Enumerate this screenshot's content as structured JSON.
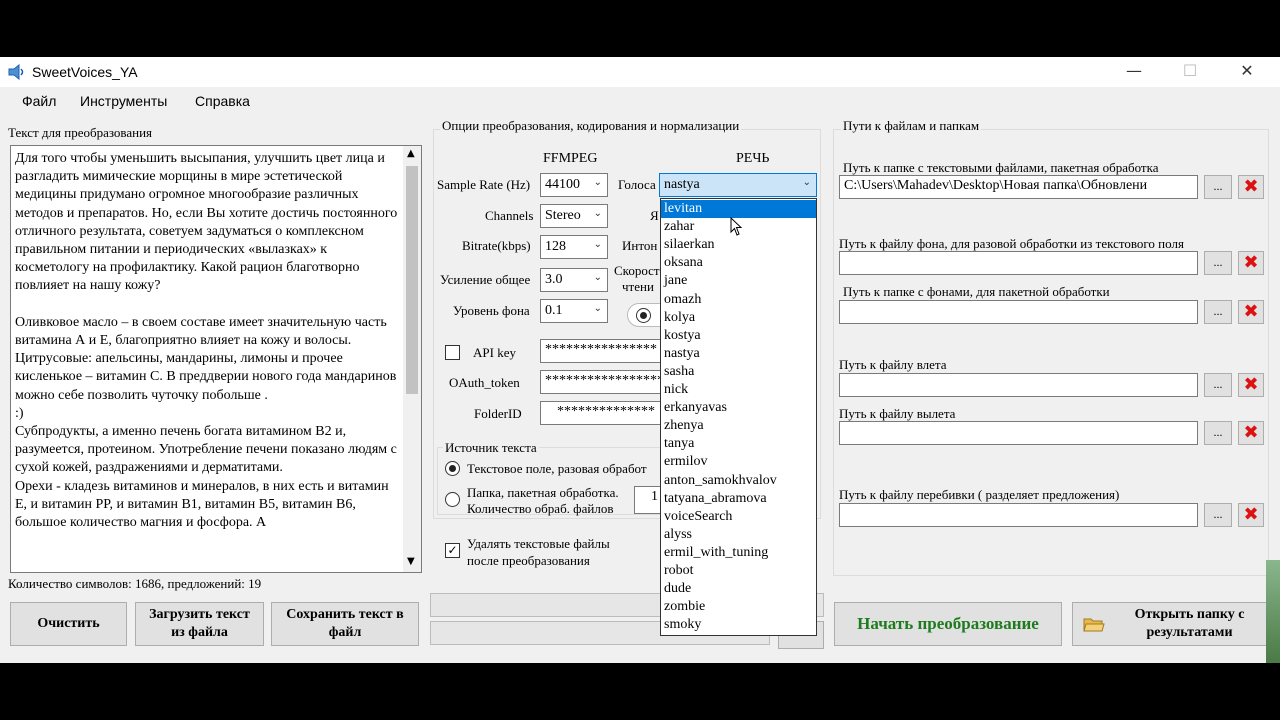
{
  "window": {
    "title": "SweetVoices_YA",
    "minimize": "—",
    "maximize": "☐",
    "close": "✕"
  },
  "menu": [
    "Файл",
    "Инструменты",
    "Справка"
  ],
  "text_panel": {
    "label": "Текст для преобразования",
    "content": "Для того чтобы уменьшить высыпания, улучшить цвет лица и разгладить мимические морщины в мире эстетической медицины придумано огромное многообразие различных методов и препаратов. Но, если Вы хотите достичь постоянного отличного результата, советуем задуматься о комплексном правильном питании и периодических «вылазках» к косметологу на профилактику. Какой рацион благотворно повлияет на нашу кожу?\n\nОливковое масло – в своем составе имеет значительную часть витамина А и Е, благоприятно влияет на кожу и волосы.\nЦитрусовые: апельсины, мандарины, лимоны и прочее кисленькое – витамин С. В преддверии нового года мандаринов можно себе позволить чуточку побольше .\n:)\nСубпродукты, а именно печень богата витамином В2 и, разумеется, протеином. Употребление печени показано людям с сухой кожей, раздражениями и дерматитами.\nОрехи - кладезь витаминов и минералов, в них есть и витамин Е, и витамин PP, и витамин В1, витамин В5, витамин В6, большое количество магния и фосфора. А",
    "stats": "Количество символов:  1686, предложений:  19"
  },
  "buttons": {
    "clear": "Очистить",
    "load": "Загрузить текст из файла",
    "save": "Сохранить текст в файл",
    "start": "Начать преобразование",
    "open_folder": "Открыть папку с результатами",
    "browse": "...",
    "remove": "✖"
  },
  "options": {
    "group_title": "Опции преобразования, кодирования и нормализации",
    "ffmpeg_header": "FFMPEG",
    "speech_header": "РЕЧЬ",
    "sample_rate_label": "Sample Rate (Hz)",
    "sample_rate_value": "44100",
    "channels_label": "Channels",
    "channels_value": "Stereo",
    "bitrate_label": "Bitrate(kbps)",
    "bitrate_value": "128",
    "gain_label": "Усиление общее",
    "gain_value": "3.0",
    "bg_level_label": "Уровень фона",
    "bg_level_value": "0.1",
    "voices_label": "Голоса",
    "voices_value": "nastya",
    "speech_lang_partial": "Я",
    "intonation_partial": "Интон",
    "speed_partial_1": "Скорост",
    "speed_partial_2": "чтени",
    "apikey_label": "API key",
    "apikey_value": "****************",
    "oauth_label": "OAuth_token",
    "oauth_value": "******************",
    "folderid_label": "FolderID",
    "folderid_value": "**************"
  },
  "source": {
    "group_title": "Источник текста",
    "text_option": "Текстовое поле, разовая обработ",
    "folder_option_1": "Папка, пакетная обработка.",
    "folder_option_2": "Количество обраб. файлов",
    "folder_count_partial": "1"
  },
  "delete_option": {
    "line1": "Удалять текстовые файлы",
    "line2": "после преобразования",
    "checked": true
  },
  "voices_list": [
    "levitan",
    "zahar",
    "silaerkan",
    "oksana",
    "jane",
    "omazh",
    "kolya",
    "kostya",
    "nastya",
    "sasha",
    "nick",
    "erkanyavas",
    "zhenya",
    "tanya",
    "ermilov",
    "anton_samokhvalov",
    "tatyana_abramova",
    "voiceSearch",
    "alyss",
    "ermil_with_tuning",
    "robot",
    "dude",
    "zombie",
    "smoky"
  ],
  "voices_selected": "levitan",
  "paths": {
    "group_title": "Пути к файлам и папкам",
    "text_folder_label": "Путь к папке с текстовыми файлами, пакетная обработка",
    "text_folder_value": "C:\\Users\\Mahadev\\Desktop\\Новая папка\\Обновлени",
    "bg_file_label": "Путь к файлу фона, для разовой обработки из текстового поля",
    "bg_file_value": "",
    "bg_folder_label": "Путь к папке с фонами, для пакетной обработки",
    "bg_folder_value": "",
    "intro_label": "Путь к файлу влета",
    "intro_value": "",
    "outro_label": "Путь к файлу вылета",
    "outro_value": "",
    "separator_label": "Путь к файлу перебивки ( разделяет предложения)",
    "separator_value": ""
  },
  "colors": {
    "accent": "#0078d7",
    "start_text": "#1e7b1e",
    "remove": "#d11111"
  },
  "icons": {
    "app": "speaker-icon",
    "folder": "folder-icon",
    "dropdown": "chevron-down-icon"
  }
}
